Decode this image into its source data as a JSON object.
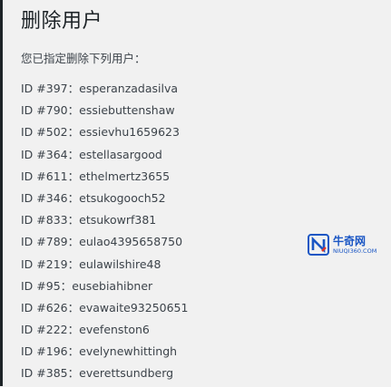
{
  "page": {
    "title": "删除用户",
    "intro": "您已指定删除下列用户："
  },
  "users": [
    {
      "id": "ID #397",
      "login": "esperanzadasilva"
    },
    {
      "id": "ID #790",
      "login": "essiebuttenshaw"
    },
    {
      "id": "ID #502",
      "login": "essievhu1659623"
    },
    {
      "id": "ID #364",
      "login": "estellasargood"
    },
    {
      "id": "ID #611",
      "login": "ethelmertz3655"
    },
    {
      "id": "ID #346",
      "login": "etsukogooch52"
    },
    {
      "id": "ID #833",
      "login": "etsukowrf381"
    },
    {
      "id": "ID #789",
      "login": "eulao4395658750"
    },
    {
      "id": "ID #219",
      "login": "eulawilshire48"
    },
    {
      "id": "ID #95",
      "login": "eusebiahibner"
    },
    {
      "id": "ID #626",
      "login": "evawaite93250651"
    },
    {
      "id": "ID #222",
      "login": "evefenston6"
    },
    {
      "id": "ID #196",
      "login": "evelynewhittingh"
    },
    {
      "id": "ID #385",
      "login": "everettsundberg"
    }
  ],
  "separator": "：",
  "watermark": {
    "name": "牛奇网",
    "url": "NIUQI360.COM",
    "logo_icon": "n-logo-icon",
    "color": "#1a56c4"
  }
}
